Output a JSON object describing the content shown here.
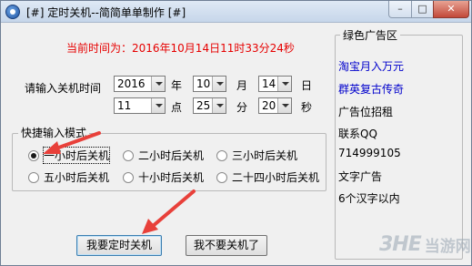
{
  "window": {
    "title": "[#] 定时关机--简简单单制作 [#]",
    "controls": {
      "minimize": "–",
      "maximize": "□",
      "close": "✕"
    }
  },
  "current_time": "当前时间为：2016年10月14日11时33分24秒",
  "shutdown_time": {
    "label": "请输入关机时间",
    "year": {
      "value": "2016",
      "unit": "年"
    },
    "month": {
      "value": "10",
      "unit": "月"
    },
    "day": {
      "value": "14",
      "unit": "日"
    },
    "hour": {
      "value": "11",
      "unit": "点"
    },
    "minute": {
      "value": "25",
      "unit": "分"
    },
    "second": {
      "value": "20",
      "unit": "秒"
    }
  },
  "quick_mode": {
    "legend": "快捷输入模式",
    "options": [
      {
        "label": "一小时后关机",
        "checked": true
      },
      {
        "label": "二小时后关机",
        "checked": false
      },
      {
        "label": "三小时后关机",
        "checked": false
      },
      {
        "label": "五小时后关机",
        "checked": false
      },
      {
        "label": "十小时后关机",
        "checked": false
      },
      {
        "label": "二十四小时后关机",
        "checked": false
      }
    ]
  },
  "buttons": {
    "shutdown": "我要定时关机",
    "cancel": "我不要关机了"
  },
  "ads": {
    "legend": "绿色广告区",
    "items": [
      {
        "text": "淘宝月入万元",
        "link": true
      },
      {
        "text": "群英复古传奇",
        "link": true
      },
      {
        "text": "广告位招租",
        "link": false
      },
      {
        "text": "联系QQ",
        "link": false
      },
      {
        "text": "714999105",
        "link": false
      },
      {
        "text": "文字广告",
        "link": false
      },
      {
        "text": "6个汉字以内",
        "link": false
      }
    ]
  },
  "watermark": {
    "logo": "3HE",
    "text": "当游网"
  },
  "colors": {
    "time_text": "#e60000",
    "ad_link": "#0000cc",
    "annotation_arrow": "#e8403a"
  }
}
